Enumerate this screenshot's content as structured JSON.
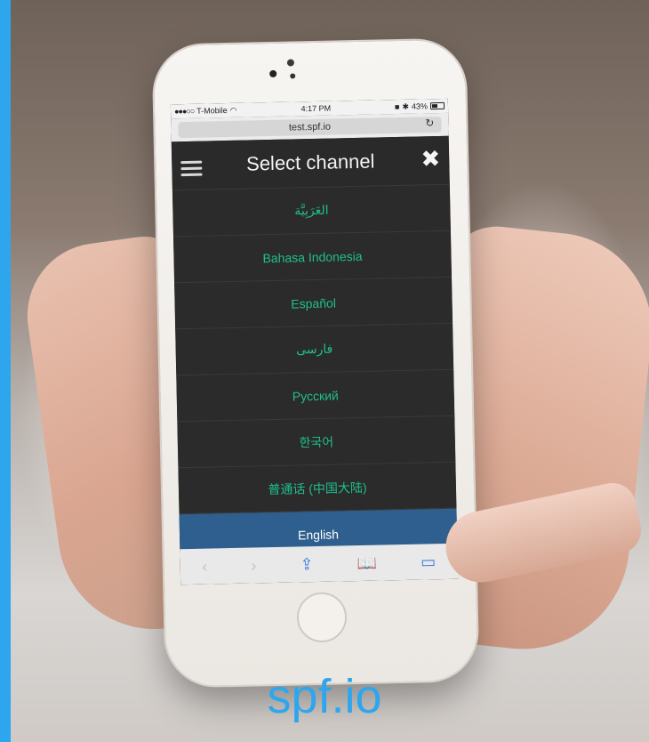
{
  "device": {
    "status_bar": {
      "carrier": "T-Mobile",
      "time": "4:17 PM",
      "battery": "43%"
    },
    "url_bar": {
      "url": "test.spf.io"
    }
  },
  "app": {
    "title": "Select channel",
    "channels": [
      {
        "label": "العَرَبِيَّة"
      },
      {
        "label": "Bahasa Indonesia"
      },
      {
        "label": "Español"
      },
      {
        "label": "فارسی"
      },
      {
        "label": "Русский"
      },
      {
        "label": "한국어"
      },
      {
        "label": "普通话 (中国大陆)"
      },
      {
        "label": "English"
      }
    ],
    "selected_index": 7
  },
  "browser_toolbar": {
    "back_icon": "chevron-left-icon",
    "forward_icon": "chevron-right-icon",
    "share_icon": "share-icon",
    "bookmarks_icon": "book-icon",
    "tabs_icon": "tabs-icon"
  },
  "brand": {
    "logo_text": "spf.io"
  },
  "colors": {
    "accent": "#2ea6ee",
    "channel_text": "#1fbf8d",
    "selected_bg": "#2f5f8e"
  }
}
